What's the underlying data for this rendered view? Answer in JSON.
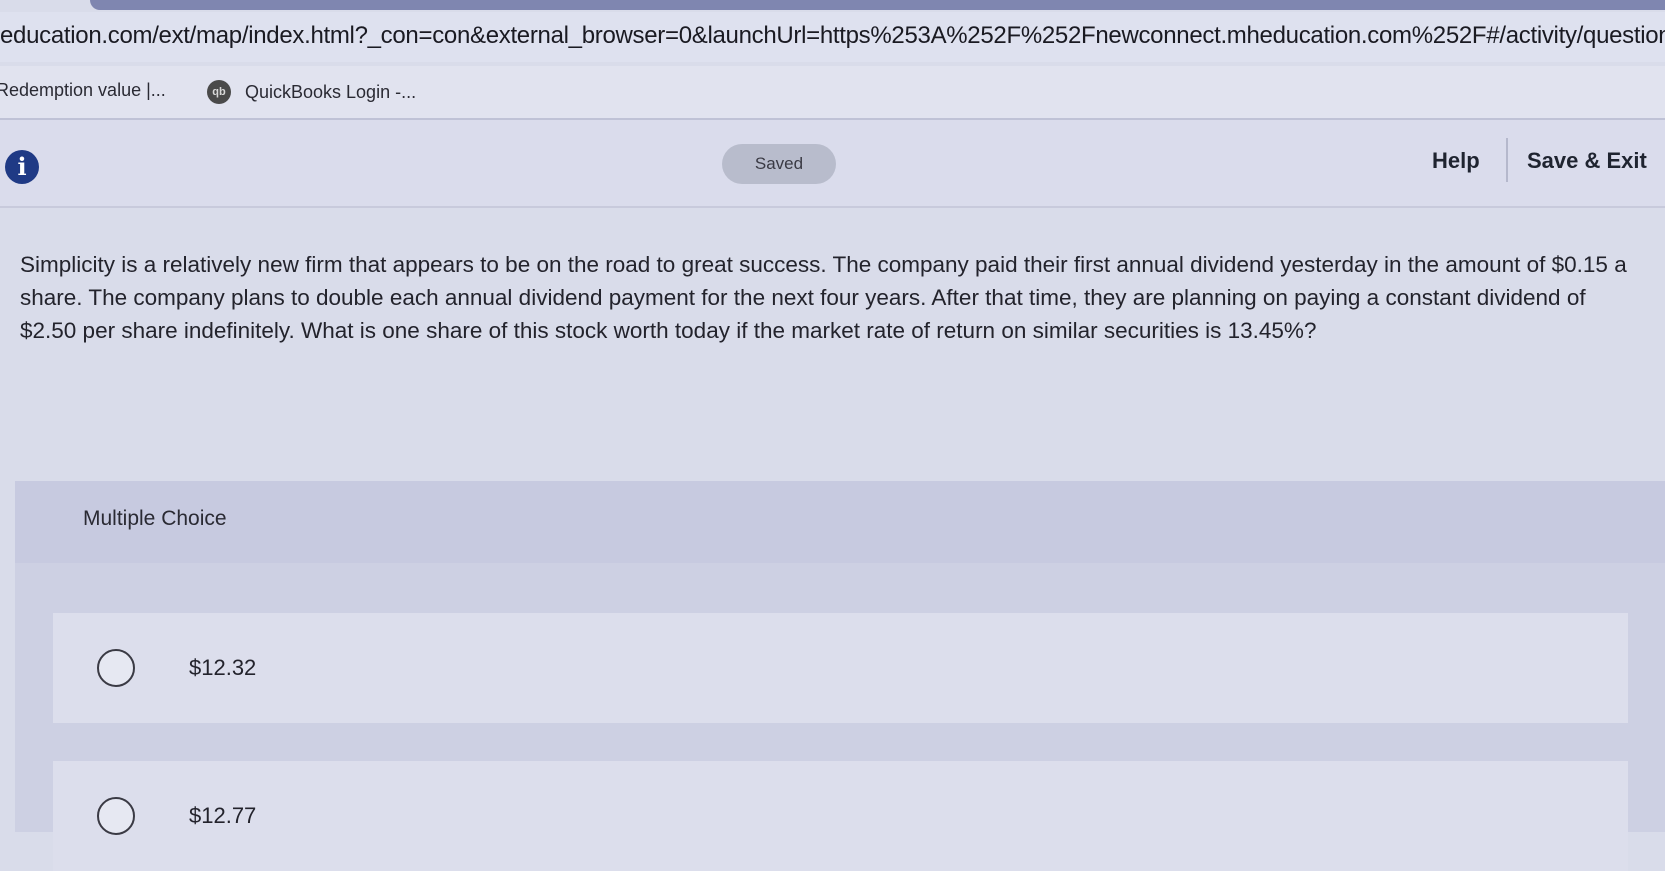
{
  "browser": {
    "url": "education.com/ext/map/index.html?_con=con&external_browser=0&launchUrl=https%253A%252F%252Fnewconnect.mheducation.com%252F#/activity/question-",
    "bookmarks": [
      {
        "label": "Redemption value |..."
      },
      {
        "icon_text": "qb",
        "label": "QuickBooks Login -..."
      }
    ]
  },
  "header": {
    "info_icon": "info-icon",
    "status": "Saved",
    "help_label": "Help",
    "save_exit_label": "Save & Exit"
  },
  "question": {
    "text": "Simplicity is a relatively new firm that appears to be on the road to great success. The company paid their first annual dividend yesterday in the amount of $0.15 a share. The company plans to double each annual dividend payment for the next four years. After that time, they are planning on paying a constant dividend of $2.50 per share indefinitely. What is one share of this stock worth today if the market rate of return on similar securities is 13.45%?"
  },
  "multiple_choice": {
    "title": "Multiple Choice",
    "options": [
      {
        "label": "$12.32"
      },
      {
        "label": "$12.77"
      }
    ]
  },
  "colors": {
    "info_icon": "#1f3a85",
    "saved_badge": "#b8bccc",
    "panel": "#cdd0e3"
  }
}
